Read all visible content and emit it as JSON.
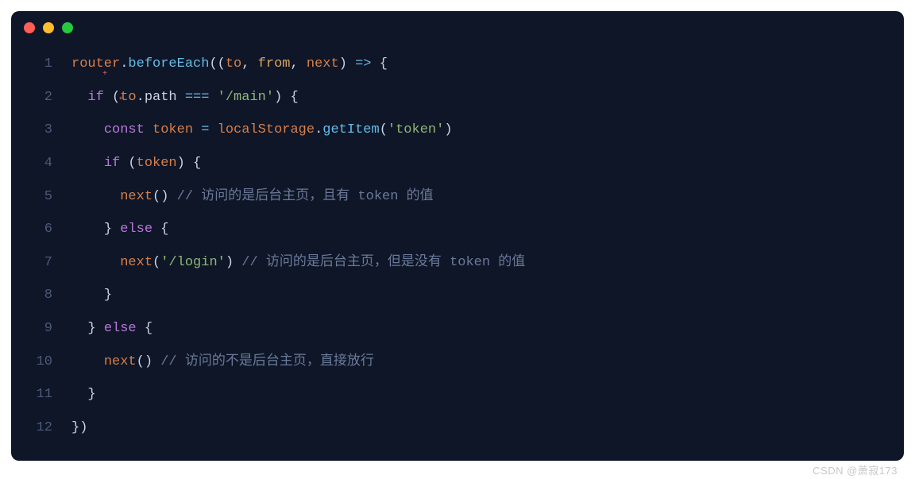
{
  "watermark": "CSDN @萧寂173",
  "traffic_lights": [
    "red",
    "yellow",
    "green"
  ],
  "code": {
    "lines": [
      {
        "n": 1,
        "indent": "",
        "tokens": [
          {
            "t": "router",
            "c": "tok-ident"
          },
          {
            "t": ".",
            "c": "tok-punct"
          },
          {
            "t": "beforeEach",
            "c": "tok-method"
          },
          {
            "t": "((",
            "c": "tok-punct"
          },
          {
            "t": "to",
            "c": "tok-ident"
          },
          {
            "t": ", ",
            "c": "tok-punct"
          },
          {
            "t": "from",
            "c": "tok-param"
          },
          {
            "t": ", ",
            "c": "tok-punct"
          },
          {
            "t": "next",
            "c": "tok-ident"
          },
          {
            "t": ") ",
            "c": "tok-punct"
          },
          {
            "t": "=>",
            "c": "tok-op"
          },
          {
            "t": " {",
            "c": "tok-punct"
          }
        ]
      },
      {
        "n": 2,
        "indent": "  ",
        "tokens": [
          {
            "t": "if",
            "c": "tok-keyword"
          },
          {
            "t": " (",
            "c": "tok-punct"
          },
          {
            "t": "to",
            "c": "tok-ident"
          },
          {
            "t": ".",
            "c": "tok-punct"
          },
          {
            "t": "path",
            "c": "tok-prop"
          },
          {
            "t": " ",
            "c": "tok-punct"
          },
          {
            "t": "===",
            "c": "tok-op"
          },
          {
            "t": " ",
            "c": "tok-punct"
          },
          {
            "t": "'/main'",
            "c": "tok-string"
          },
          {
            "t": ") {",
            "c": "tok-punct"
          }
        ]
      },
      {
        "n": 3,
        "indent": "    ",
        "tokens": [
          {
            "t": "const",
            "c": "tok-keyword"
          },
          {
            "t": " ",
            "c": "tok-punct"
          },
          {
            "t": "token",
            "c": "tok-ident"
          },
          {
            "t": " ",
            "c": "tok-punct"
          },
          {
            "t": "=",
            "c": "tok-op"
          },
          {
            "t": " ",
            "c": "tok-punct"
          },
          {
            "t": "localStorage",
            "c": "tok-builtin"
          },
          {
            "t": ".",
            "c": "tok-punct"
          },
          {
            "t": "getItem",
            "c": "tok-method"
          },
          {
            "t": "(",
            "c": "tok-punct"
          },
          {
            "t": "'token'",
            "c": "tok-string"
          },
          {
            "t": ")",
            "c": "tok-punct"
          }
        ]
      },
      {
        "n": 4,
        "indent": "    ",
        "tokens": [
          {
            "t": "if",
            "c": "tok-keyword"
          },
          {
            "t": " (",
            "c": "tok-punct"
          },
          {
            "t": "token",
            "c": "tok-ident"
          },
          {
            "t": ") {",
            "c": "tok-punct"
          }
        ]
      },
      {
        "n": 5,
        "indent": "      ",
        "tokens": [
          {
            "t": "next",
            "c": "tok-ident"
          },
          {
            "t": "() ",
            "c": "tok-punct"
          },
          {
            "t": "// 访问的是后台主页，且有 ",
            "c": "tok-comment"
          },
          {
            "t": "token",
            "c": "tok-commentkw"
          },
          {
            "t": " 的值",
            "c": "tok-comment"
          }
        ]
      },
      {
        "n": 6,
        "indent": "    ",
        "tokens": [
          {
            "t": "} ",
            "c": "tok-punct"
          },
          {
            "t": "else",
            "c": "tok-keyword"
          },
          {
            "t": " {",
            "c": "tok-punct"
          }
        ]
      },
      {
        "n": 7,
        "indent": "      ",
        "tokens": [
          {
            "t": "next",
            "c": "tok-ident"
          },
          {
            "t": "(",
            "c": "tok-punct"
          },
          {
            "t": "'/login'",
            "c": "tok-string"
          },
          {
            "t": ") ",
            "c": "tok-punct"
          },
          {
            "t": "// 访问的是后台主页，但是没有 ",
            "c": "tok-comment"
          },
          {
            "t": "token",
            "c": "tok-commentkw"
          },
          {
            "t": " 的值",
            "c": "tok-comment"
          }
        ]
      },
      {
        "n": 8,
        "indent": "    ",
        "tokens": [
          {
            "t": "}",
            "c": "tok-punct"
          }
        ]
      },
      {
        "n": 9,
        "indent": "  ",
        "tokens": [
          {
            "t": "} ",
            "c": "tok-punct"
          },
          {
            "t": "else",
            "c": "tok-keyword"
          },
          {
            "t": " {",
            "c": "tok-punct"
          }
        ]
      },
      {
        "n": 10,
        "indent": "    ",
        "tokens": [
          {
            "t": "next",
            "c": "tok-ident"
          },
          {
            "t": "() ",
            "c": "tok-punct"
          },
          {
            "t": "// 访问的不是后台主页，直接放行",
            "c": "tok-comment"
          }
        ]
      },
      {
        "n": 11,
        "indent": "  ",
        "tokens": [
          {
            "t": "}",
            "c": "tok-punct"
          }
        ]
      },
      {
        "n": 12,
        "indent": "",
        "tokens": [
          {
            "t": "})",
            "c": "tok-punct"
          }
        ]
      }
    ]
  }
}
